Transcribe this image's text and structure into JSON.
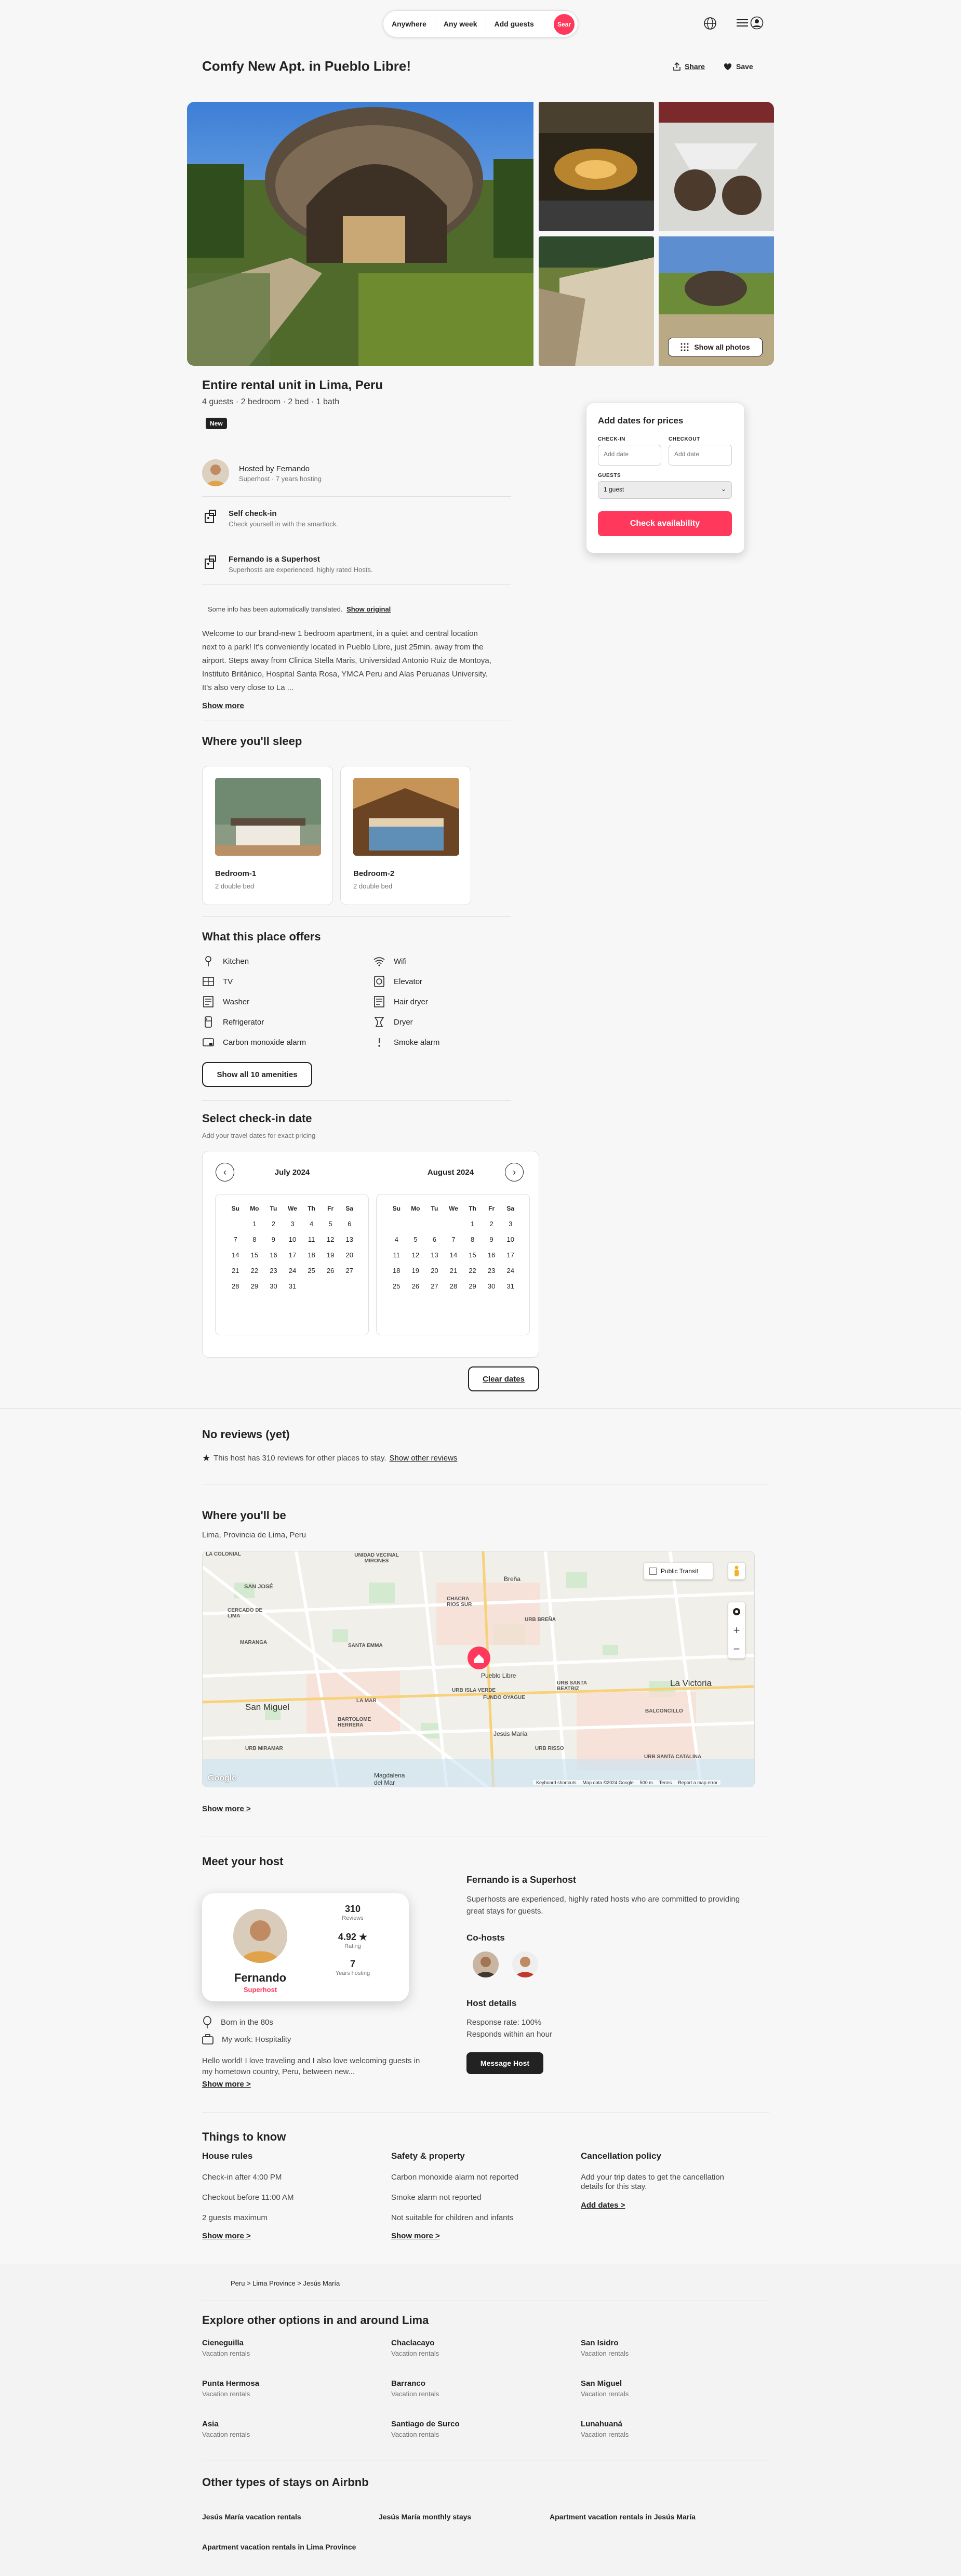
{
  "header": {
    "search": [
      "Anywhere",
      "Any week",
      "Add guests"
    ],
    "search_button": "Sear"
  },
  "listing": {
    "title": "Comfy New Apt. in Pueblo Libre!",
    "share": "Share",
    "save": "Save",
    "show_all_photos": "Show all photos",
    "subtitle": "Entire rental unit in Lima, Peru",
    "details": "4 guests · 2 bedroom · 2 bed · 1 bath",
    "badge": "New"
  },
  "host_rows": [
    {
      "title": "Hosted by Fernando",
      "sub": "Superhost · 7 years hosting"
    },
    {
      "title": "Self check-in",
      "sub": "Check yourself in with the smartlock."
    },
    {
      "title": "Fernando is a Superhost",
      "sub": "Superhosts are experienced, highly rated Hosts."
    }
  ],
  "translate": {
    "note": "Some info has been automatically translated.",
    "link": "Show original"
  },
  "description": [
    "Welcome to our brand-new 1 bedroom apartment, in a quiet and central location",
    "next to a park! It's conveniently located in Pueblo Libre, just 25min. away from the",
    "airport. Steps away from Clinica Stella Maris, Universidad Antonio Ruiz de Montoya,",
    "Instituto Británico, Hospital Santa Rosa, YMCA Peru and Alas Peruanas University.",
    "It's also very close to La ..."
  ],
  "show_more": "Show more",
  "booking": {
    "title": "Add dates for prices",
    "checkin_label": "CHECK-IN",
    "checkout_label": "CHECKOUT",
    "checkin_placeholder": "Add date",
    "checkout_placeholder": "Add date",
    "guests_label": "GUESTS",
    "guests_value": "1 guest",
    "button": "Check availability"
  },
  "sleep": {
    "heading": "Where you'll sleep",
    "rooms": [
      {
        "name": "Bedroom-1",
        "bed": "2 double bed"
      },
      {
        "name": "Bedroom-2",
        "bed": "2 double bed"
      }
    ]
  },
  "amenities": {
    "heading": "What this place offers",
    "left": [
      "Kitchen",
      "TV",
      "Washer",
      "Refrigerator",
      "Carbon monoxide alarm"
    ],
    "right": [
      "Wifi",
      "Elevator",
      "Hair dryer",
      "Dryer",
      "Smoke alarm"
    ],
    "button": "Show all 10 amenities"
  },
  "calendar": {
    "heading": "Select check-in date",
    "sub": "Add your travel dates for exact pricing",
    "months": [
      {
        "name": "July 2024",
        "offset": 1,
        "days": 31
      },
      {
        "name": "August 2024",
        "offset": 4,
        "days": 31
      }
    ],
    "weekdays": [
      "Su",
      "Mo",
      "Tu",
      "We",
      "Th",
      "Fr",
      "Sa"
    ],
    "clear": "Clear dates"
  },
  "reviews": {
    "heading": "No reviews (yet)",
    "text": "This host has 310 reviews for other places to stay.",
    "link": "Show other reviews"
  },
  "location": {
    "heading": "Where you'll be",
    "place": "Lima, Provincia de Lima, Peru",
    "map_labels": [
      "LA COLONIAL",
      "UNIDAD VECINAL MIRONES",
      "Breña",
      "SAN JOSÉ",
      "CHACRA RIOS SUR",
      "URB BREÑA",
      "CERCADO DE LIMA",
      "SANTA EMMA",
      "Pueblo Libre",
      "MARANGA",
      "URB ISLA VERDE",
      "FUNDO OYAGUE",
      "URB SANTA BEATRIZ",
      "La Victoria",
      "San Miguel",
      "LA MAR",
      "BARTOLOME HERRERA",
      "Jesús María",
      "BALCONCILLO",
      "URB MIRAMAR",
      "URB RISSO",
      "URB SANTA CATALINA",
      "Magdalena del Mar"
    ],
    "transit": "Public Transit",
    "attribution": [
      "Keyboard shortcuts",
      "Map data ©2024 Google",
      "500 m",
      "Terms",
      "Report a map error"
    ],
    "show_more": "Show more >"
  },
  "host": {
    "heading": "Meet your host",
    "name": "Fernando",
    "badge": "Superhost",
    "stats": [
      {
        "value": "310",
        "label": "Reviews"
      },
      {
        "value": "4.92 ★",
        "label": "Rating"
      },
      {
        "value": "7",
        "label": "Years hosting"
      }
    ],
    "born": "Born in the 80s",
    "work": "My work: Hospitality",
    "bio": [
      "Hello world! I love traveling and I also love welcoming guests in",
      "my hometown country, Peru, between new..."
    ],
    "show_more": "Show more >",
    "superhost_title": "Fernando is a Superhost",
    "superhost_text": [
      "Superhosts are experienced, highly rated hosts who are committed to providing",
      "great stays for guests."
    ],
    "cohosts": "Co-hosts",
    "details_title": "Host details",
    "response_rate": "Response rate: 100%",
    "responds": "Responds within an hour",
    "message": "Message Host"
  },
  "things": {
    "heading": "Things to know",
    "house_rules": {
      "title": "House rules",
      "items": [
        "Check-in after 4:00 PM",
        "Checkout before 11:00 AM",
        "2 guests maximum"
      ],
      "more": "Show more >"
    },
    "safety": {
      "title": "Safety & property",
      "items": [
        "Carbon monoxide alarm not reported",
        "Smoke alarm not reported",
        "Not suitable for children and infants"
      ],
      "more": "Show more >"
    },
    "cancel": {
      "title": "Cancellation policy",
      "text": [
        "Add your trip dates to get the cancellation",
        "details for this stay."
      ],
      "more": "Add dates >"
    }
  },
  "breadcrumb": "Peru > Lima Province > Jesús María",
  "explore": {
    "heading": "Explore other options in and around Lima",
    "items": [
      {
        "name": "Cieneguilla",
        "sub": "Vacation rentals"
      },
      {
        "name": "Chaclacayo",
        "sub": "Vacation rentals"
      },
      {
        "name": "San Isidro",
        "sub": "Vacation rentals"
      },
      {
        "name": "Punta Hermosa",
        "sub": "Vacation rentals"
      },
      {
        "name": "Barranco",
        "sub": "Vacation rentals"
      },
      {
        "name": "San Miguel",
        "sub": "Vacation rentals"
      },
      {
        "name": "Asia",
        "sub": "Vacation rentals"
      },
      {
        "name": "Santiago de Surco",
        "sub": "Vacation rentals"
      },
      {
        "name": "Lunahuaná",
        "sub": "Vacation rentals"
      }
    ]
  },
  "other": {
    "heading": "Other types of stays on Airbnb",
    "items": [
      "Jesús María vacation rentals",
      "Jesús María monthly stays",
      "Apartment vacation rentals in Jesús María",
      "Apartment vacation rentals in Lima Province"
    ]
  },
  "colors": {
    "brand": "#ff385c",
    "text": "#222222",
    "muted": "#717171"
  }
}
